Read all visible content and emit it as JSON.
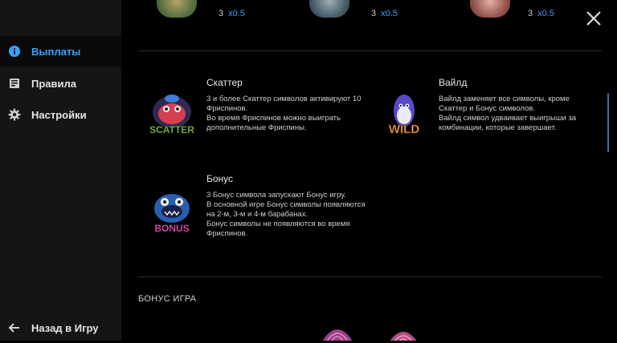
{
  "sidebar": {
    "items": [
      {
        "label": "Выплаты",
        "icon": "info-icon",
        "active": true
      },
      {
        "label": "Правила",
        "icon": "book-icon",
        "active": false
      },
      {
        "label": "Настройки",
        "icon": "gear-icon",
        "active": false
      }
    ],
    "back": {
      "label": "Назад в Игру",
      "icon": "arrow-left-icon"
    }
  },
  "colors": {
    "accent": "#3aa0ff",
    "sidebar_bg": "#151515",
    "main_bg": "#000000"
  },
  "paytable_top": [
    {
      "count": "3",
      "mult": "x0.5"
    },
    {
      "count": "3",
      "mult": "x0.5"
    },
    {
      "count": "3",
      "mult": "x0.5"
    }
  ],
  "symbols": {
    "scatter": {
      "title": "Скаттер",
      "badge": "SCATTER",
      "desc": "3 и более Скаттер символов активируют 10 Фриспинов.\nВо время Фриспинов можно выиграть дополнительные Фриспины."
    },
    "wild": {
      "title": "Вайлд",
      "badge": "WILD",
      "desc": "Вайлд заменяет все символы, кроме Скаттер и Бонус символов.\nВайлд символ удваивает выигрыши за комбинации, которые завершает."
    },
    "bonus": {
      "title": "Бонус",
      "badge": "BONUS",
      "desc": "3 Бонус символа запускают Бонус игру.\nВ основной игре Бонус символы появляются на 2-м, 3-м и 4-м барабанах.\nБонус символы не появляются во время Фриспинов."
    }
  },
  "bonus_section": {
    "title": "БОНУС ИГРА"
  }
}
